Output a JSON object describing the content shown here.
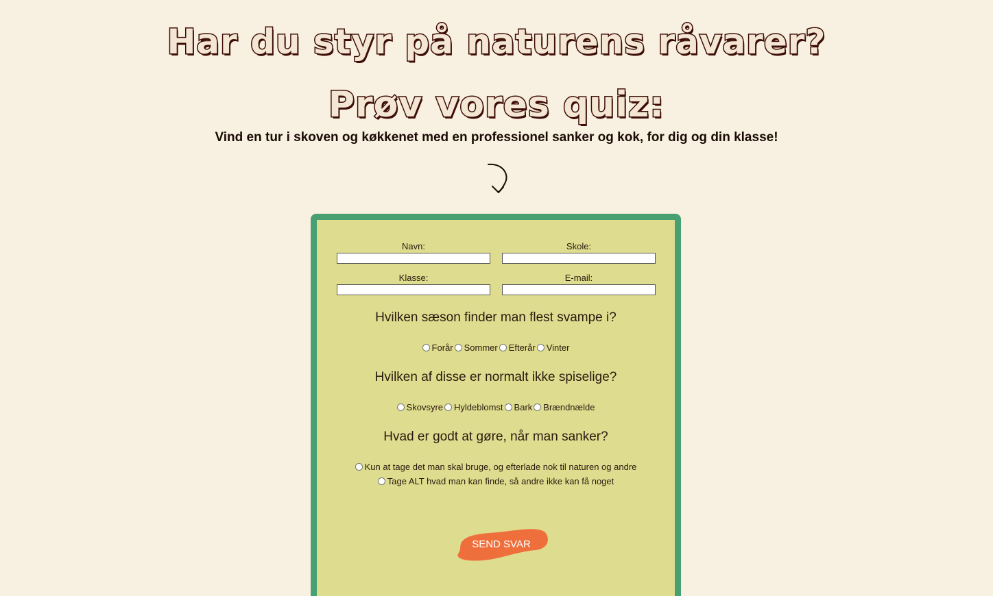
{
  "header": {
    "title_line1": "Har du styr på naturens råvarer?",
    "title_line2": "Prøv vores quiz:",
    "tagline": "Vind en tur i skoven og køkkenet med en professionel sanker og kok, for dig og din klasse!",
    "arrow_icon": "curved-arrow-down-icon"
  },
  "form": {
    "fields": {
      "navn": {
        "label": "Navn:",
        "value": ""
      },
      "skole": {
        "label": "Skole:",
        "value": ""
      },
      "klasse": {
        "label": "Klasse:",
        "value": ""
      },
      "email": {
        "label": "E-mail:",
        "value": ""
      }
    },
    "questions": [
      {
        "text": "Hvilken sæson finder man flest svampe i?",
        "options": [
          "Forår",
          "Sommer",
          "Efterår",
          "Vinter"
        ]
      },
      {
        "text": "Hvilken af disse er normalt ikke spiselige?",
        "options": [
          "Skovsyre",
          "Hyldeblomst",
          "Bark",
          "Brændnælde"
        ]
      },
      {
        "text": "Hvad er godt at gøre, når man sanker?",
        "options": [
          "Kun at tage det man skal bruge, og efterlade nok til naturen og andre",
          "Tage ALT hvad man kan finde, så andre ikke kan få noget"
        ]
      }
    ],
    "submit_label": "SEND SVAR"
  },
  "colors": {
    "page_background": "#f8f0e0",
    "card_background": "#dedc8e",
    "card_border": "#47a071",
    "button": "#ef6f3c",
    "headline_outline": "#3d0d08"
  }
}
